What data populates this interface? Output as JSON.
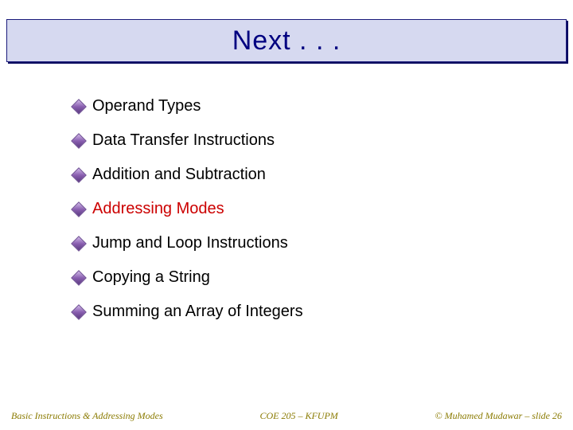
{
  "title": "Next . . .",
  "bullets": [
    {
      "text": "Operand Types",
      "highlight": false
    },
    {
      "text": "Data Transfer Instructions",
      "highlight": false
    },
    {
      "text": "Addition and Subtraction",
      "highlight": false
    },
    {
      "text": "Addressing Modes",
      "highlight": true
    },
    {
      "text": "Jump and Loop Instructions",
      "highlight": false
    },
    {
      "text": "Copying a String",
      "highlight": false
    },
    {
      "text": "Summing an Array of Integers",
      "highlight": false
    }
  ],
  "footer": {
    "left": "Basic Instructions & Addressing Modes",
    "center": "COE 205 – KFUPM",
    "right": "© Muhamed Mudawar – slide 26"
  }
}
